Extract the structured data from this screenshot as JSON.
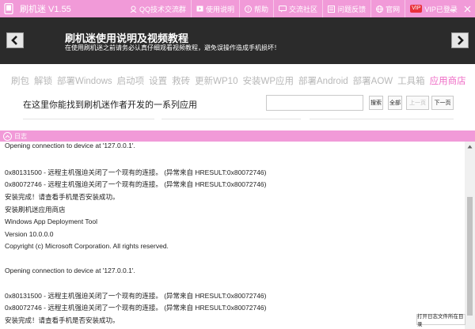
{
  "titlebar": {
    "app_title": "刷机迷 V1.55",
    "items": [
      {
        "label": "QQ技术交流群",
        "icon": "qq-group-icon"
      },
      {
        "label": "使用说明",
        "icon": "video-icon"
      },
      {
        "label": "帮助",
        "icon": "help-icon"
      },
      {
        "label": "交流社区",
        "icon": "community-icon"
      },
      {
        "label": "问题反馈",
        "icon": "feedback-icon"
      },
      {
        "label": "官网",
        "icon": "globe-icon"
      },
      {
        "label": "VIP已登录",
        "badge": "VIP",
        "icon": "vip-icon"
      }
    ]
  },
  "banner": {
    "title": "刷机迷使用说明及视频教程",
    "subtitle": "在使用刷机迷之前请务必认真仔细观看视频教程，避免误操作造成手机损坏！"
  },
  "nav": {
    "items": [
      "刷包",
      "解锁",
      "部署Windows",
      "启动项",
      "设置",
      "救砖",
      "更新WP10",
      "安装WP应用",
      "部署Android",
      "部署AOW",
      "工具箱",
      "应用商店"
    ],
    "active_index": 11
  },
  "store": {
    "heading": "在这里你能找到刷机迷作者开发的一系列应用",
    "search_value": "",
    "search_label": "搜索",
    "all_label": "全部",
    "prev_label": "上一页",
    "next_label": "下一页"
  },
  "log": {
    "title": "日志",
    "lines": [
      "Opening connection to device at '127.0.0.1'.",
      "",
      "0x80131500 - 远程主机强迫关闭了一个现有的连接。 (异常来自 HRESULT:0x80072746)",
      "0x80072746 - 远程主机强迫关闭了一个现有的连接。 (异常来自 HRESULT:0x80072746)",
      "安装完成！请查看手机是否安装成功。",
      "安装刷机迷应用商店",
      "Windows App Deployment Tool",
      "Version 10.0.0.0",
      "Copyright (c) Microsoft Corporation. All rights reserved.",
      "",
      "Opening connection to device at '127.0.0.1'.",
      "",
      "0x80131500 - 远程主机强迫关闭了一个现有的连接。 (异常来自 HRESULT:0x80072746)",
      "0x80072746 - 远程主机强迫关闭了一个现有的连接。 (异常来自 HRESULT:0x80072746)",
      "安装完成！请查看手机是否安装成功。"
    ],
    "open_dir_label": "打开日志文件所在目录"
  },
  "colors": {
    "accent": "#f19ad8",
    "nav_active": "#ef6cc6",
    "banner_bg": "#2b2b2b"
  }
}
